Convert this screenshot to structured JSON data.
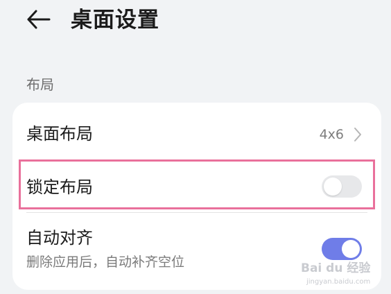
{
  "header": {
    "back_icon": "arrow-left-icon",
    "title": "桌面设置"
  },
  "section": {
    "label": "布局"
  },
  "settings": [
    {
      "label": "桌面布局",
      "value": "4x6",
      "icon": "chevron-right-icon"
    },
    {
      "label": "锁定布局",
      "toggle": "off"
    },
    {
      "label": "自动对齐",
      "description": "删除应用后，自动补齐空位",
      "toggle": "on"
    }
  ],
  "colors": {
    "background": "#f1f3f5",
    "card": "#ffffff",
    "toggle_on": "#6f7de8",
    "toggle_off": "#e7e8ea",
    "highlight": "#e9709b"
  },
  "watermark": {
    "text": "Bai du 经验",
    "subtext": "jingyan.baidu.com"
  }
}
